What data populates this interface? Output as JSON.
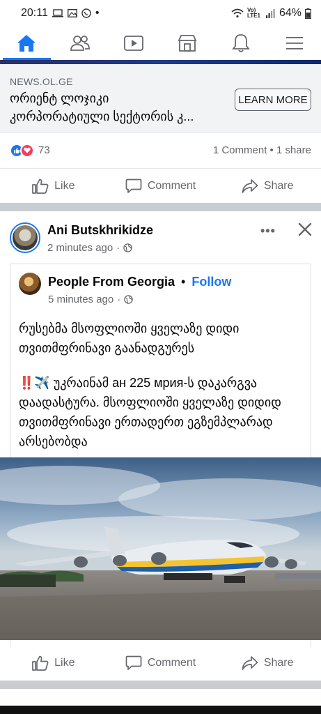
{
  "status_bar": {
    "time": "20:11",
    "dot": "•",
    "network_label": "Vo) LTE1",
    "battery": "64%"
  },
  "nav": {
    "items": [
      {
        "name": "home",
        "icon": "home-icon",
        "active": true
      },
      {
        "name": "friends",
        "icon": "friends-icon",
        "active": false
      },
      {
        "name": "watch",
        "icon": "video-icon",
        "active": false
      },
      {
        "name": "marketplace",
        "icon": "marketplace-icon",
        "active": false
      },
      {
        "name": "notifications",
        "icon": "bell-icon",
        "active": false
      },
      {
        "name": "menu",
        "icon": "hamburger-icon",
        "active": false
      }
    ],
    "accent": "#1877f2"
  },
  "ad_post": {
    "source": "NEWS.OL.GE",
    "title_line1": "ორიენტ ლოჯიკი",
    "title_line2": "კორპორატიული სექტორის კ...",
    "cta": "LEARN MORE",
    "reaction_count": "73",
    "comments_shares": "1 Comment • 1 share"
  },
  "actions": {
    "like": "Like",
    "comment": "Comment",
    "share": "Share"
  },
  "post": {
    "author": "Ani Butskhrikidze",
    "time": "2 minutes ago",
    "more": "•••",
    "shared": {
      "page_name": "People From Georgia",
      "separator": "•",
      "follow": "Follow",
      "time": "5 minutes ago",
      "paragraph1": "რუსებმა მსოფლიოში ყველაზე დიდი თვითმფრინავი გაანადგურეს",
      "paragraph2_emoji": "‼️✈️",
      "paragraph2": " უკრაინამ ан 225 мрия-ს დაკარგვა დაადასტურა. მსოფლიოში ყველაზე დიდიდ თვითმფრინავი ერთადერთ ეგზემპლარად არსებობდა"
    }
  },
  "colors": {
    "primary": "#1877f2",
    "love": "#f33e58",
    "secondary_text": "#65676b",
    "divider": "#c9ccd1"
  }
}
